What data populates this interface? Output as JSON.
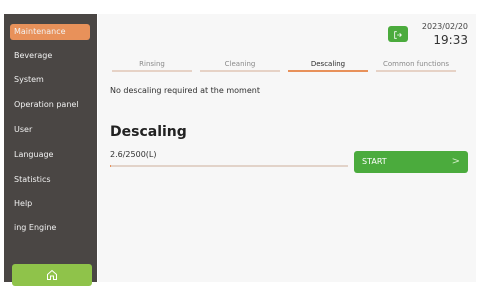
{
  "colors": {
    "sidebar_bg": "#4a4644",
    "accent_orange": "#e8915a",
    "accent_green": "#4bab3d",
    "home_green": "#8fc34a",
    "main_bg": "#f7f7f7"
  },
  "sidebar": {
    "items": [
      {
        "label": "Maintenance",
        "active": true
      },
      {
        "label": "Beverage",
        "active": false
      },
      {
        "label": "System",
        "active": false
      },
      {
        "label": "Operation panel",
        "active": false
      },
      {
        "label": "User",
        "active": false
      },
      {
        "label": "Language",
        "active": false
      },
      {
        "label": "Statistics",
        "active": false
      },
      {
        "label": "Help",
        "active": false
      },
      {
        "label": "ing    Engine",
        "active": false
      }
    ],
    "home_icon": "home-icon"
  },
  "header": {
    "back_icon": "logout-icon",
    "date": "2023/02/20",
    "time": "19:33"
  },
  "tabs": [
    {
      "label": "Rinsing",
      "active": false
    },
    {
      "label": "Cleaning",
      "active": false
    },
    {
      "label": "Descaling",
      "active": true
    },
    {
      "label": "Common functions",
      "active": false
    }
  ],
  "main": {
    "message": "No descaling required at the moment",
    "section_title": "Descaling",
    "progress_text": "2.6/2500(L)",
    "progress_fraction": 0.001,
    "start_label": "START",
    "start_chevron": ">"
  }
}
